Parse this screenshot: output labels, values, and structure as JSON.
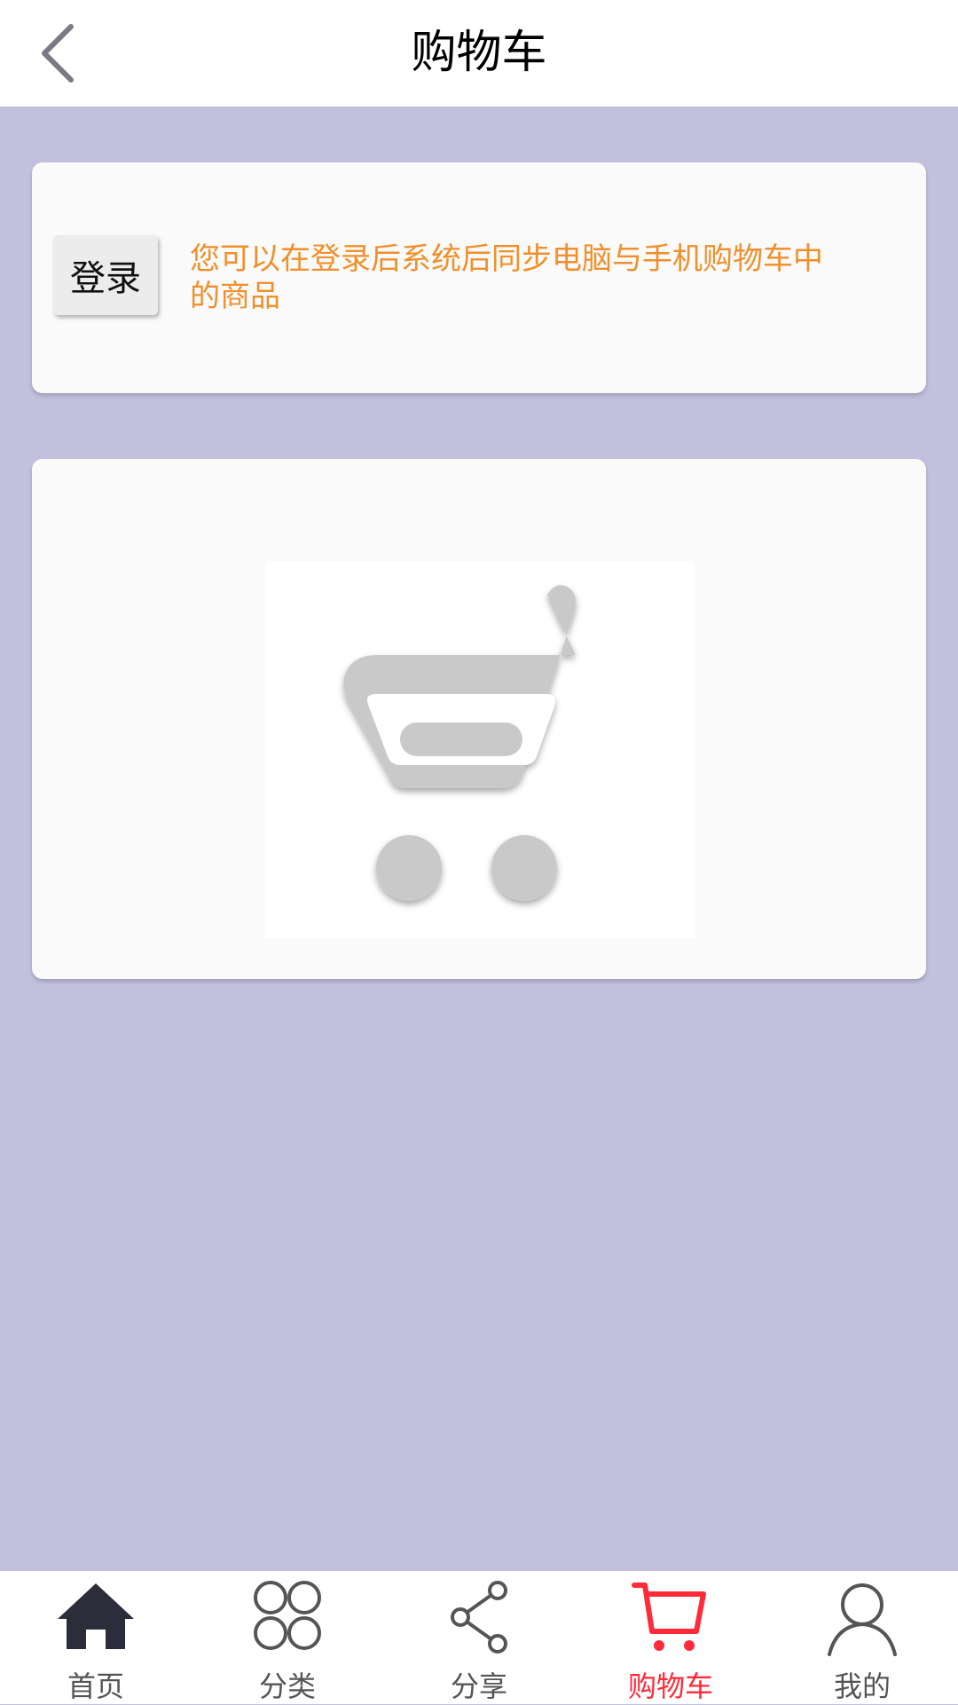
{
  "header": {
    "title": "购物车",
    "back_icon": "chevron-left-icon"
  },
  "login_card": {
    "button_label": "登录",
    "hint": "您可以在登录后系统后同步电脑与手机购物车中的商品"
  },
  "empty_cart": {
    "icon": "shopping-cart-icon"
  },
  "tabbar": {
    "items": [
      {
        "label": "首页",
        "icon": "home-icon",
        "active": false
      },
      {
        "label": "分类",
        "icon": "grid-icon",
        "active": false
      },
      {
        "label": "分享",
        "icon": "share-icon",
        "active": false
      },
      {
        "label": "购物车",
        "icon": "cart-icon",
        "active": true
      },
      {
        "label": "我的",
        "icon": "user-icon",
        "active": false
      }
    ]
  },
  "colors": {
    "page_background": "#c3c0de",
    "hint_text": "#f0902c",
    "active_tab": "#ff2a3a",
    "home_icon": "#2d2c3b"
  }
}
